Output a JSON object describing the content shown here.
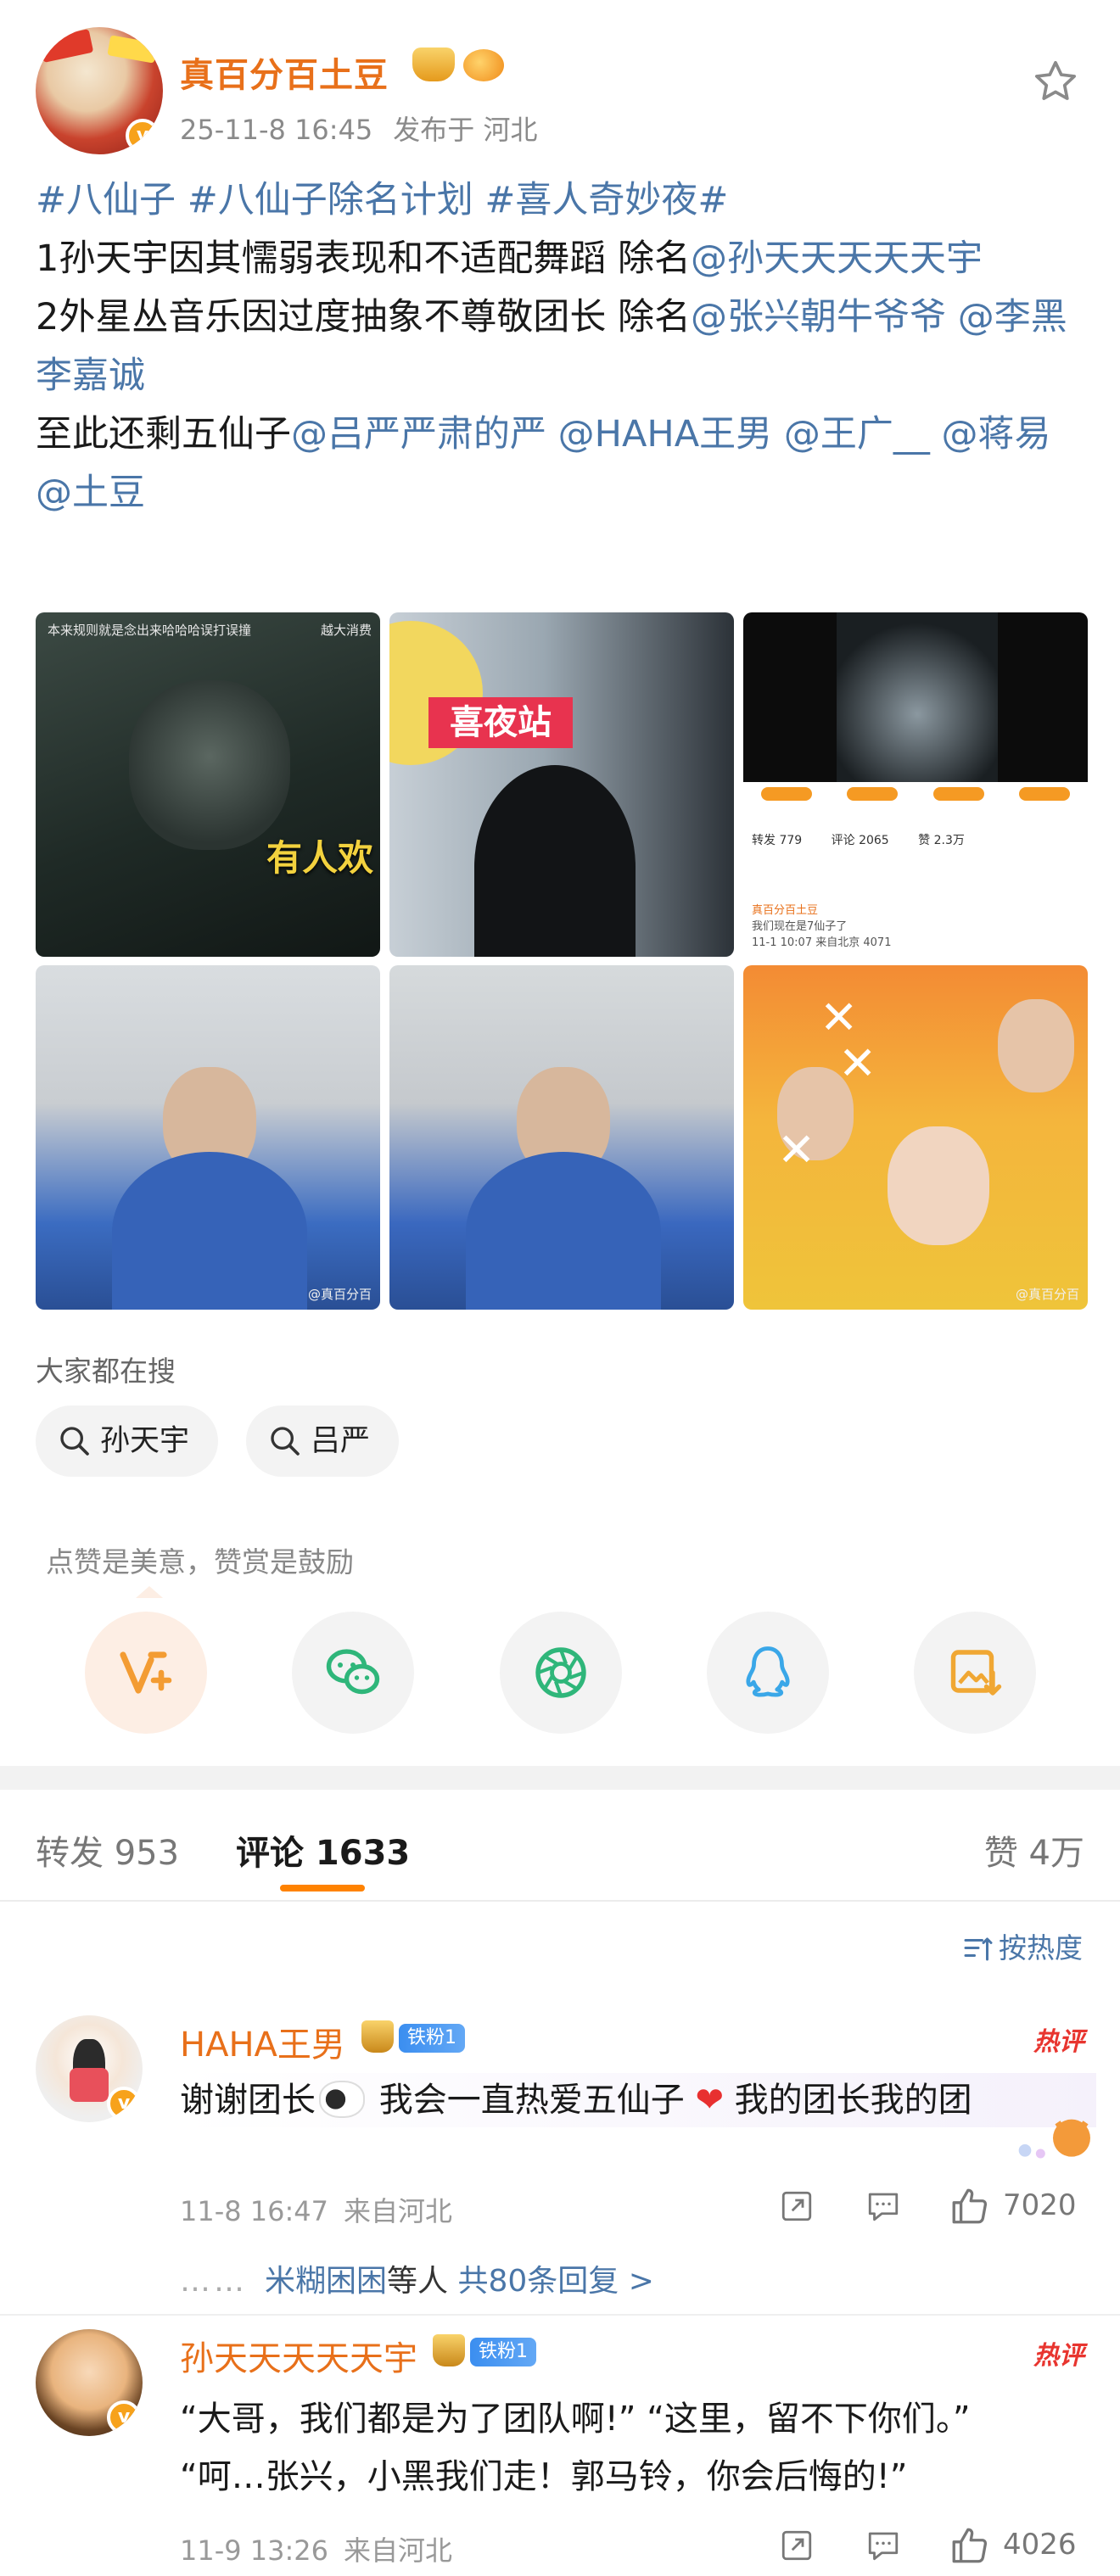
{
  "post": {
    "author": "真百分百土豆",
    "timestamp": "25-11-8 16:45",
    "location": "发布于 河北",
    "text": {
      "line1": [
        {
          "t": "#八仙子",
          "link": true
        },
        {
          "t": " ",
          "link": false
        },
        {
          "t": "#八仙子除名计划",
          "link": true
        },
        {
          "t": " ",
          "link": false
        },
        {
          "t": "#喜人奇妙夜#",
          "link": true
        }
      ],
      "line2": [
        {
          "t": "1孙天宇因其懦弱表现和不适配舞蹈 除名",
          "link": false
        },
        {
          "t": "@孙天天天天天宇",
          "link": true
        }
      ],
      "line3": [
        {
          "t": "2外星丛音乐因过度抽象不尊敬团长 除名",
          "link": false
        },
        {
          "t": "@张兴朝牛爷爷",
          "link": true
        },
        {
          "t": " ",
          "link": false
        },
        {
          "t": "@李黑李嘉诚",
          "link": true
        }
      ],
      "line4": [
        {
          "t": "至此还剩五仙子",
          "link": false
        },
        {
          "t": "@吕严严肃的严",
          "link": true
        },
        {
          "t": " ",
          "link": false
        },
        {
          "t": "@HAHA王男",
          "link": true
        },
        {
          "t": " ",
          "link": false
        },
        {
          "t": "@王广__",
          "link": true
        },
        {
          "t": " ",
          "link": false
        },
        {
          "t": "@蒋易",
          "link": true
        },
        {
          "t": " ",
          "link": false
        },
        {
          "t": "@土豆",
          "link": true
        }
      ]
    },
    "images": {
      "t1_top": "本来规则就是念出来哈哈哈误打误撞",
      "t1_sub": "越大消费",
      "t1_caption": "有人欢",
      "t2_sign": "喜夜站",
      "t3_counts": [
        "转发 779",
        "评论 2065",
        "赞 2.3万"
      ],
      "t3_author": "真百分百土豆",
      "t3_comment": "我们现在是7仙子了",
      "t3_meta": "11-1 10:07 来自北京",
      "t3_likes": "4071",
      "watermark": "@真百分百"
    }
  },
  "search": {
    "title": "大家都在搜",
    "chips": [
      "孙天宇",
      "吕严"
    ]
  },
  "reward": {
    "text": "点赞是美意，赞赏是鼓励"
  },
  "share_buttons": [
    "reward-v-icon",
    "wechat-icon",
    "moments-icon",
    "qq-icon",
    "save-image-icon"
  ],
  "tabs": {
    "repost": "转发 953",
    "comment": "评论 1633",
    "like": "赞 4万"
  },
  "sort": {
    "label": "按热度"
  },
  "comments": [
    {
      "name": "HAHA王男",
      "fan_badge": "铁粉1",
      "hot": "热评",
      "text_a": "谢谢团长",
      "text_b": " 我会一直热爱五仙子",
      "text_c": " 我的团长我的团",
      "time": "11-8 16:47",
      "location": "来自河北",
      "likes": "7020",
      "reply_dots": "……",
      "reply_user": "米糊困困",
      "reply_mid": "等人",
      "reply_link": " 共80条回复 >"
    },
    {
      "name": "孙天天天天天宇",
      "fan_badge": "铁粉1",
      "hot": "热评",
      "line1": "“大哥，我们都是为了团队啊!” “这里，留不下你们。”",
      "line2": "“呵…张兴，小黑我们走！郭马铃，你会后悔的!”",
      "time": "11-9 13:26",
      "location": "来自河北",
      "likes": "4026"
    }
  ],
  "colors": {
    "accent_orange": "#e8701a",
    "link_blue": "#4a76a8",
    "tab_underline": "#ff8200",
    "hot_red": "#e8352f"
  }
}
